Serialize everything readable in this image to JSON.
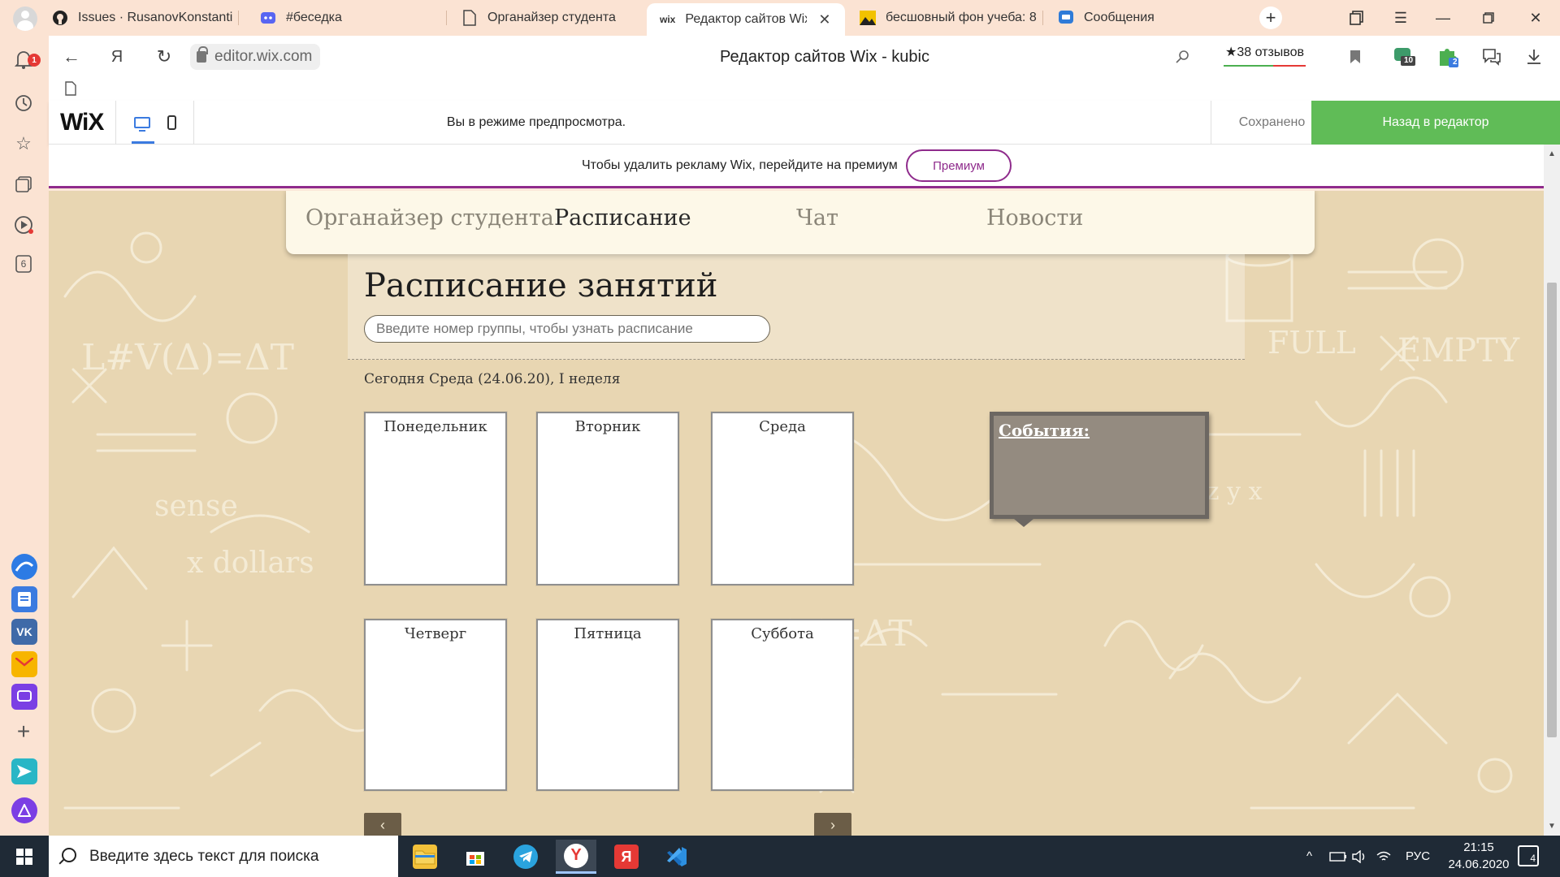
{
  "browser": {
    "tabs": [
      {
        "label": "Issues · RusanovKonstanti",
        "icon": "github-icon"
      },
      {
        "label": "#беседка",
        "icon": "discord-icon"
      },
      {
        "label": "Органайзер студента",
        "icon": "page-icon"
      },
      {
        "label": "Редактор сайтов Wix",
        "icon": "wix-icon",
        "active": true
      },
      {
        "label": "бесшовный фон учеба: 8",
        "icon": "image-icon"
      },
      {
        "label": "Сообщения",
        "icon": "vk-messages-icon"
      }
    ],
    "wix_tab_icon_text": "wix",
    "address": "editor.wix.com",
    "page_title": "Редактор сайтов Wix - kubic",
    "reviews": "★38 отзывов",
    "sidebar_badge": "1",
    "sidebar_tabs_count": "6",
    "extension_badges": [
      "10",
      "2"
    ]
  },
  "wix_bar": {
    "logo": "WiX",
    "preview_message": "Вы в режиме предпросмотра.",
    "saved": "Сохранено",
    "back_button": "Назад в редактор"
  },
  "ad": {
    "text": "Чтобы удалить рекламу Wix, перейдите на премиум",
    "premium_button": "Премиум",
    "accent": "#8f2b8c"
  },
  "site": {
    "menu": [
      "Органайзер студента",
      "Расписание",
      "Чат",
      "Новости"
    ],
    "title": "Расписание занятий",
    "search_placeholder": "Введите номер группы, чтобы узнать расписание",
    "today": "Сегодня Среда (24.06.20), I неделя",
    "days": [
      "Понедельник",
      "Вторник",
      "Среда",
      "Четверг",
      "Пятница",
      "Суббота"
    ],
    "events_title": "События:",
    "prev_arrow": "‹",
    "next_arrow": "›"
  },
  "taskbar": {
    "search_placeholder": "Введите здесь текст для поиска",
    "language": "РУС",
    "time": "21:15",
    "date": "24.06.2020",
    "notifications": "4"
  }
}
